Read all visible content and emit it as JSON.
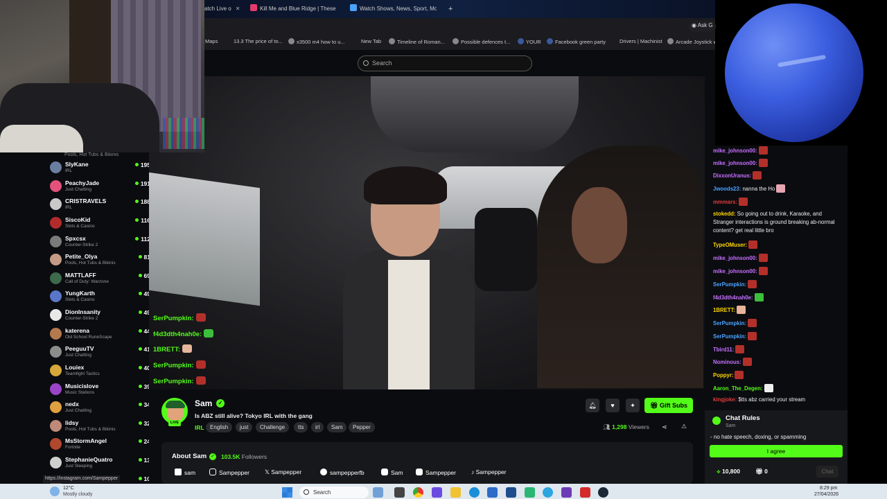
{
  "browser": {
    "tabs": [
      {
        "label": "atch Live o",
        "icon_color": "#53fc18"
      },
      {
        "label": "Kill Me and Blue Ridge | These",
        "icon_color": "#e23b6b"
      },
      {
        "label": "Watch Shows, News, Sport, Mo",
        "icon_color": "#4aa3ff"
      }
    ],
    "new_tab": "+",
    "ask_button": "Ask G",
    "bookmarks": [
      "Maps",
      "13.3 The price of to...",
      "x3500 m4 how to u...",
      "New Tab",
      "Timeline of Roman...",
      "Possible defences t...",
      "YOUR",
      "Facebook green party",
      "Drivers | Machinist",
      "Arcade Joystick w"
    ]
  },
  "header": {
    "search_placeholder": "Search"
  },
  "sidebar": {
    "prev_category": "Pools, Hot Tubs & Bikinis",
    "items": [
      {
        "name": "SlyKane",
        "category": "IRL",
        "viewers": "195",
        "color": "#6a7ea0"
      },
      {
        "name": "PeachyJade",
        "category": "Just Chatting",
        "viewers": "191",
        "color": "#e3527a"
      },
      {
        "name": "CRISTRAVELS",
        "category": "IRL",
        "viewers": "188",
        "color": "#c9c9c9"
      },
      {
        "name": "SiscoKid",
        "category": "Slots & Casino",
        "viewers": "116",
        "color": "#b12b2b"
      },
      {
        "name": "Spxcsx",
        "category": "Counter-Strike 2",
        "viewers": "112",
        "color": "#7b7b7b"
      },
      {
        "name": "Petite_Olya",
        "category": "Pools, Hot Tubs & Bikinis",
        "viewers": "81",
        "color": "#c49a86"
      },
      {
        "name": "MATTLAFF",
        "category": "Call of Duty: Warzone",
        "viewers": "69",
        "color": "#3d6a4a"
      },
      {
        "name": "YungKarth",
        "category": "Slots & Casino",
        "viewers": "49",
        "color": "#5a76c8"
      },
      {
        "name": "DionInsanity",
        "category": "Counter-Strike 2",
        "viewers": "49",
        "color": "#e8e8e8"
      },
      {
        "name": "katerena",
        "category": "Old School RuneScape",
        "viewers": "44",
        "color": "#b5794e"
      },
      {
        "name": "PeeguuTV",
        "category": "Just Chatting",
        "viewers": "41",
        "color": "#8c8c8c"
      },
      {
        "name": "Louiex",
        "category": "Teamfight Tactics",
        "viewers": "40",
        "color": "#d6a83a"
      },
      {
        "name": "Musicislove",
        "category": "Music Stations",
        "viewers": "39",
        "color": "#9a45c8"
      },
      {
        "name": "nedx",
        "category": "Just Chatting",
        "viewers": "34",
        "color": "#e0a040"
      },
      {
        "name": "lidsy",
        "category": "Pools, Hot Tubs & Bikinis",
        "viewers": "32",
        "color": "#c08a7a"
      },
      {
        "name": "MsStormAngel",
        "category": "Fortnite",
        "viewers": "24",
        "color": "#b0482e"
      },
      {
        "name": "StephanieQuatro",
        "category": "Just Sleeping",
        "viewers": "13",
        "color": "#cfcfcf"
      },
      {
        "name": "",
        "category": "",
        "viewers": "10",
        "color": "#444"
      }
    ]
  },
  "video_chat": [
    {
      "user": "SerPumpkin:",
      "color": "#53fc18",
      "emote": "#b3302a"
    },
    {
      "user": "f4d3dth4nah0e:",
      "color": "#53fc18",
      "emote": "#3bbf3b"
    },
    {
      "user": "1BRETT:",
      "color": "#53fc18",
      "emote": "#e6b59a"
    },
    {
      "user": "SerPumpkin:",
      "color": "#53fc18",
      "emote": "#b3302a"
    },
    {
      "user": "SerPumpkin:",
      "color": "#53fc18",
      "emote": "#b3302a"
    }
  ],
  "channel": {
    "name": "Sam",
    "live_badge": "LIVE",
    "title": "Is ABZ still alive? Tokyo IRL with the gang",
    "category": "IRL",
    "tags": [
      "English",
      "just",
      "Challenge",
      "tts",
      "irl",
      "Sam",
      "Pepper"
    ],
    "viewers_count": "1,298",
    "viewers_label": "Viewers",
    "gift_subs": "Gift Subs",
    "about_title": "About Sam",
    "followers_count": "103.5K",
    "followers_label": "Followers",
    "socials": [
      "sam",
      "Sampepper",
      "Sampepper",
      "sampepperfb",
      "Sam",
      "Sampepper",
      "Sampepper"
    ],
    "status_url": "https://instagram.com/Sampepper"
  },
  "chat": {
    "messages": [
      {
        "user": "mike_johnson00:",
        "color": "#c770ff",
        "text": "",
        "emote": "#b3302a"
      },
      {
        "user": "mike_johnson00:",
        "color": "#c770ff",
        "text": "",
        "emote": "#b3302a"
      },
      {
        "user": "DixxonUranus:",
        "color": "#c770ff",
        "text": "",
        "emote": "#b3302a"
      },
      {
        "user": "Jwoods23:",
        "color": "#4aa3ff",
        "text": "nanna the Ho",
        "emote": "#e6a6b0"
      },
      {
        "user": "mmmars:",
        "color": "#e23b3b",
        "text": "",
        "emote": "#b3302a"
      },
      {
        "user": "TypeOMuser:",
        "color": "#ffd700",
        "text": "",
        "emote": "#b3302a"
      },
      {
        "user": "mike_johnson00:",
        "color": "#c770ff",
        "text": "",
        "emote": "#b3302a"
      },
      {
        "user": "mike_johnson00:",
        "color": "#c770ff",
        "text": "",
        "emote": "#b3302a"
      },
      {
        "user": "SerPumpkin:",
        "color": "#4aa3ff",
        "text": "",
        "emote": "#b3302a"
      },
      {
        "user": "f4d3dth4nah0e:",
        "color": "#c770ff",
        "text": "",
        "emote": "#3bbf3b"
      },
      {
        "user": "1BRETT:",
        "color": "#ffd700",
        "text": "",
        "emote": "#e6b59a"
      },
      {
        "user": "SerPumpkin:",
        "color": "#4aa3ff",
        "text": "",
        "emote": "#b3302a"
      },
      {
        "user": "SerPumpkin:",
        "color": "#4aa3ff",
        "text": "",
        "emote": "#b3302a"
      },
      {
        "user": "Tbird11:",
        "color": "#c770ff",
        "text": "",
        "emote": "#b3302a"
      },
      {
        "user": "Nominous:",
        "color": "#c770ff",
        "text": "",
        "emote": "#b3302a"
      },
      {
        "user": "Poppyr:",
        "color": "#ffd700",
        "text": "",
        "emote": "#b3302a"
      },
      {
        "user": "Aaron_The_Degen:",
        "color": "#53fc18",
        "text": "",
        "emote": "#eeeeee"
      },
      {
        "user": "kingjoke:",
        "color": "#e23b3b",
        "text": "$tts abz carried your stream",
        "emote": ""
      }
    ],
    "long_message": {
      "user": "stokedd:",
      "color": "#ffd700",
      "text": "So going out to drink, Karaoke, and Stranger interactions is ground breaking ab-normal content? get real little bro"
    }
  },
  "rules": {
    "title": "Chat Rules",
    "subtitle": "Sam",
    "text": "- no hate speech, doxing, or spamming",
    "agree": "I agree",
    "points": "10,800",
    "gifts": "0",
    "chat_button": "Chat"
  },
  "taskbar": {
    "weather_temp": "12°C",
    "weather_desc": "Mostly cloudy",
    "search": "Search",
    "time": "8:29 pm",
    "date": "27/04/2026"
  }
}
